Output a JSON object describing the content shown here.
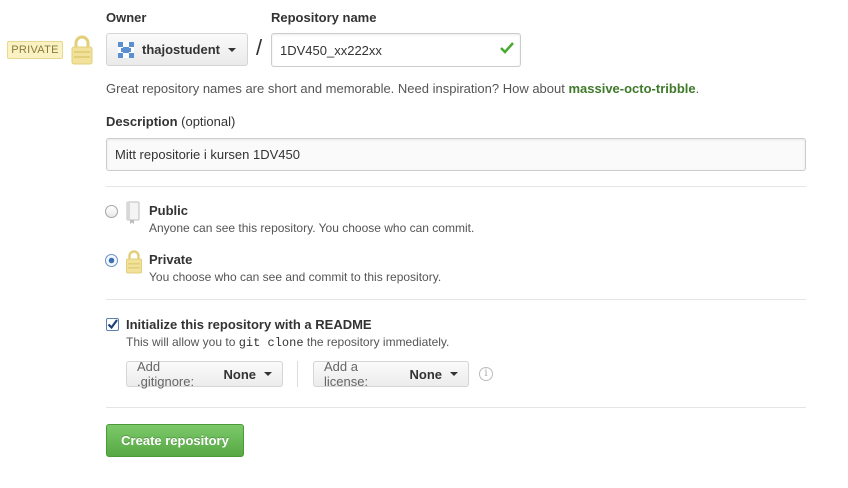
{
  "badge": {
    "private": "PRIVATE"
  },
  "owner": {
    "label": "Owner",
    "name": "thajostudent"
  },
  "repo": {
    "label": "Repository name",
    "value": "1DV450_xx222xx",
    "slash": "/"
  },
  "hint": {
    "text": "Great repository names are short and memorable. Need inspiration? How about ",
    "suggestion": "massive-octo-tribble",
    "end": "."
  },
  "description": {
    "label": "Description",
    "optional": "(optional)",
    "value": "Mitt repositorie i kursen 1DV450"
  },
  "visibility": {
    "public": {
      "title": "Public",
      "sub": "Anyone can see this repository. You choose who can commit."
    },
    "private": {
      "title": "Private",
      "sub": "You choose who can see and commit to this repository.",
      "selected": true
    }
  },
  "readme": {
    "label": "Initialize this repository with a README",
    "sub_before": "This will allow you to ",
    "sub_code": "git clone",
    "sub_after": " the repository immediately.",
    "checked": true
  },
  "gitignore": {
    "label": "Add .gitignore:",
    "value": "None"
  },
  "license": {
    "label": "Add a license:",
    "value": "None"
  },
  "info": {
    "glyph": "i"
  },
  "create": {
    "label": "Create repository"
  },
  "colors": {
    "accent_green": "#57a844",
    "link_green": "#3e7a2a",
    "badge_bg": "#fbf2c4"
  }
}
